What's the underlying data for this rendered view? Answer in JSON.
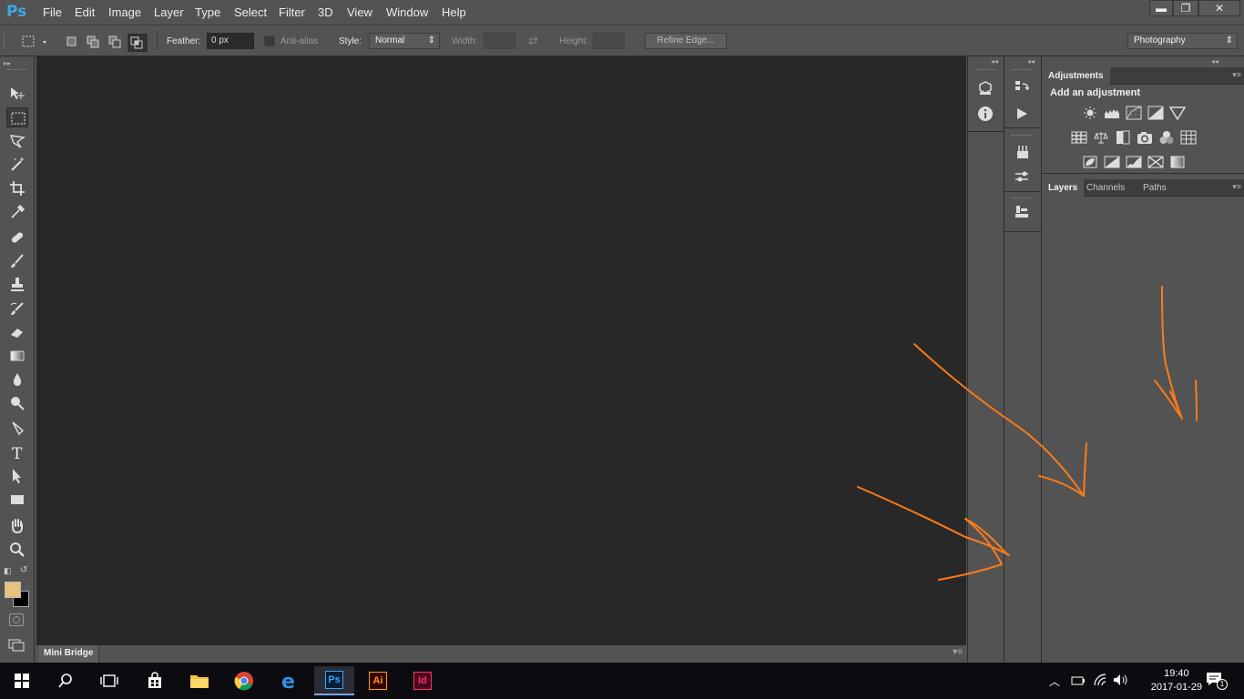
{
  "app": {
    "logo": "Ps"
  },
  "menu": [
    "File",
    "Edit",
    "Image",
    "Layer",
    "Type",
    "Select",
    "Filter",
    "3D",
    "View",
    "Window",
    "Help"
  ],
  "window_controls": {
    "minimize": "▬",
    "restore": "❐",
    "close": "✕"
  },
  "options": {
    "feather_label": "Feather:",
    "feather_value": "0 px",
    "antialias_label": "Anti-alias",
    "style_label": "Style:",
    "style_value": "Normal",
    "width_label": "Width:",
    "height_label": "Height:",
    "refine_edge": "Refine Edge...",
    "workspace": "Photography"
  },
  "tools": [
    "move-tool",
    "marquee-tool",
    "lasso-tool",
    "magic-wand-tool",
    "crop-tool",
    "eyedropper-tool",
    "healing-brush-tool",
    "brush-tool",
    "clone-stamp-tool",
    "history-brush-tool",
    "eraser-tool",
    "gradient-tool",
    "blur-tool",
    "dodge-tool",
    "pen-tool",
    "type-tool",
    "path-selection-tool",
    "rectangle-tool",
    "hand-tool",
    "zoom-tool"
  ],
  "colors": {
    "foreground": "#e9c27f",
    "background": "#000000",
    "annotation": "#ff7a1a",
    "canvas": "#282828",
    "ps_blue": "#3ea6e8"
  },
  "minibridge": {
    "label": "Mini Bridge"
  },
  "adjustments": {
    "tab": "Adjustments",
    "heading": "Add an adjustment"
  },
  "layers_panel": {
    "tabs": [
      "Layers",
      "Channels",
      "Paths"
    ]
  },
  "taskbar": {
    "time": "19:40",
    "date": "2017-01-29",
    "notification_count": "1",
    "apps": [
      {
        "name": "Ps",
        "color": "#31a8ff",
        "bg": "#001e36"
      },
      {
        "name": "Ai",
        "color": "#ff9a00",
        "bg": "#330000"
      },
      {
        "name": "Id",
        "color": "#ff3366",
        "bg": "#49021f"
      }
    ]
  }
}
